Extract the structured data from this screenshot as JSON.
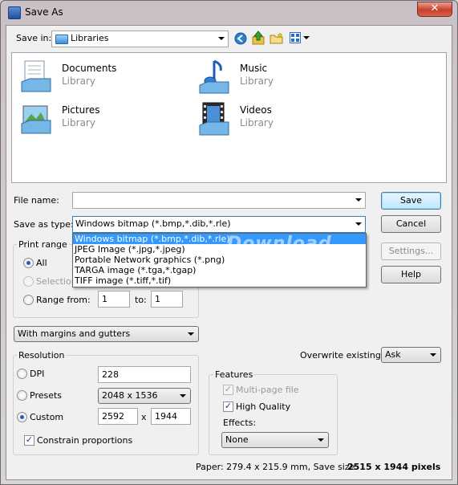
{
  "window": {
    "title": "Save As",
    "close_glyph": "✕"
  },
  "toolbar": {
    "save_in_label": "Save in:",
    "save_in_value": "Libraries"
  },
  "libraries": [
    {
      "name": "Documents",
      "sub": "Library",
      "icon": "documents-library-icon"
    },
    {
      "name": "Music",
      "sub": "Library",
      "icon": "music-library-icon"
    },
    {
      "name": "Pictures",
      "sub": "Library",
      "icon": "pictures-library-icon"
    },
    {
      "name": "Videos",
      "sub": "Library",
      "icon": "videos-library-icon"
    }
  ],
  "file_name": {
    "label": "File name:",
    "value": ""
  },
  "save_as_type": {
    "label": "Save as type:",
    "value": "Windows bitmap (*.bmp,*.dib,*.rle)",
    "options": [
      "Windows bitmap (*.bmp,*.dib,*.rle)",
      "JPEG Image (*.jpg,*.jpeg)",
      "Portable Network graphics (*.png)",
      "TARGA image (*.tga,*.tgap)",
      "TIFF image (*.tiff,*.tif)"
    ]
  },
  "buttons": {
    "save": "Save",
    "cancel": "Cancel",
    "settings": "Settings...",
    "help": "Help"
  },
  "print_range": {
    "label": "Print range",
    "all": "All",
    "selection": "Selection",
    "range_from": "Range from:",
    "from_value": "1",
    "to_label": "to:",
    "to_value": "1"
  },
  "margins": {
    "value": "With margins and gutters"
  },
  "resolution": {
    "label": "Resolution",
    "dpi_label": "DPI",
    "dpi_value": "228",
    "presets_label": "Presets",
    "presets_value": "2048 x 1536",
    "custom_label": "Custom",
    "custom_width": "2592",
    "x_label": "x",
    "custom_height": "1944",
    "constrain_label": "Constrain proportions"
  },
  "overwrite": {
    "label": "Overwrite existing:",
    "value": "Ask"
  },
  "features": {
    "label": "Features",
    "multipage": "Multi-page file",
    "high_quality": "High Quality",
    "effects_label": "Effects:",
    "effects_value": "None"
  },
  "status": {
    "paper": "Paper: 279.4 x 215.9 mm, Save size:",
    "size": "2515 x 1944 pixels"
  },
  "watermark": "Download"
}
